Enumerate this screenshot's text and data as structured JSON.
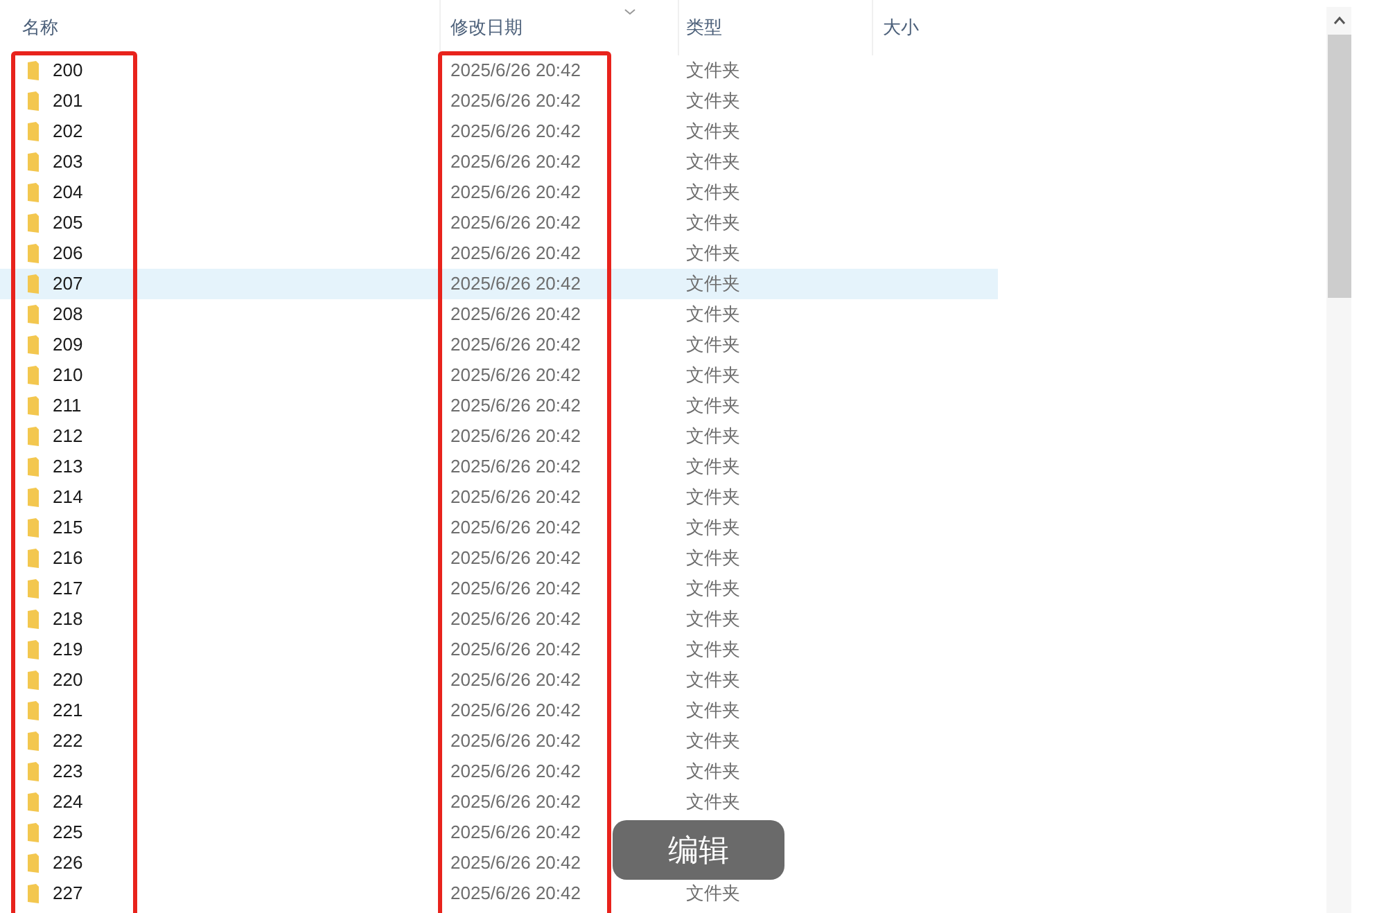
{
  "columns": [
    {
      "label": "名称",
      "sorted": false,
      "framed": true
    },
    {
      "label": "修改日期",
      "sorted": true,
      "framed": true
    },
    {
      "label": "类型",
      "sorted": false,
      "framed": false
    },
    {
      "label": "大小",
      "sorted": false,
      "framed": false
    }
  ],
  "rows": [
    {
      "name": "200",
      "modified": "2025/6/26 20:42",
      "type": "文件夹",
      "selected": false
    },
    {
      "name": "201",
      "modified": "2025/6/26 20:42",
      "type": "文件夹",
      "selected": false
    },
    {
      "name": "202",
      "modified": "2025/6/26 20:42",
      "type": "文件夹",
      "selected": false
    },
    {
      "name": "203",
      "modified": "2025/6/26 20:42",
      "type": "文件夹",
      "selected": false
    },
    {
      "name": "204",
      "modified": "2025/6/26 20:42",
      "type": "文件夹",
      "selected": false
    },
    {
      "name": "205",
      "modified": "2025/6/26 20:42",
      "type": "文件夹",
      "selected": false
    },
    {
      "name": "206",
      "modified": "2025/6/26 20:42",
      "type": "文件夹",
      "selected": false
    },
    {
      "name": "207",
      "modified": "2025/6/26 20:42",
      "type": "文件夹",
      "selected": true
    },
    {
      "name": "208",
      "modified": "2025/6/26 20:42",
      "type": "文件夹",
      "selected": false
    },
    {
      "name": "209",
      "modified": "2025/6/26 20:42",
      "type": "文件夹",
      "selected": false
    },
    {
      "name": "210",
      "modified": "2025/6/26 20:42",
      "type": "文件夹",
      "selected": false
    },
    {
      "name": "211",
      "modified": "2025/6/26 20:42",
      "type": "文件夹",
      "selected": false
    },
    {
      "name": "212",
      "modified": "2025/6/26 20:42",
      "type": "文件夹",
      "selected": false
    },
    {
      "name": "213",
      "modified": "2025/6/26 20:42",
      "type": "文件夹",
      "selected": false
    },
    {
      "name": "214",
      "modified": "2025/6/26 20:42",
      "type": "文件夹",
      "selected": false
    },
    {
      "name": "215",
      "modified": "2025/6/26 20:42",
      "type": "文件夹",
      "selected": false
    },
    {
      "name": "216",
      "modified": "2025/6/26 20:42",
      "type": "文件夹",
      "selected": false
    },
    {
      "name": "217",
      "modified": "2025/6/26 20:42",
      "type": "文件夹",
      "selected": false
    },
    {
      "name": "218",
      "modified": "2025/6/26 20:42",
      "type": "文件夹",
      "selected": false
    },
    {
      "name": "219",
      "modified": "2025/6/26 20:42",
      "type": "文件夹",
      "selected": false
    },
    {
      "name": "220",
      "modified": "2025/6/26 20:42",
      "type": "文件夹",
      "selected": false
    },
    {
      "name": "221",
      "modified": "2025/6/26 20:42",
      "type": "文件夹",
      "selected": false
    },
    {
      "name": "222",
      "modified": "2025/6/26 20:42",
      "type": "文件夹",
      "selected": false
    },
    {
      "name": "223",
      "modified": "2025/6/26 20:42",
      "type": "文件夹",
      "selected": false
    },
    {
      "name": "224",
      "modified": "2025/6/26 20:42",
      "type": "文件夹",
      "selected": false
    },
    {
      "name": "225",
      "modified": "2025/6/26 20:42",
      "selected": false
    },
    {
      "name": "226",
      "modified": "2025/6/26 20:42",
      "selected": false
    },
    {
      "name": "227",
      "modified": "2025/6/26 20:42",
      "type": "文件夹",
      "selected": false
    }
  ],
  "edit_button": {
    "label": "编辑"
  }
}
